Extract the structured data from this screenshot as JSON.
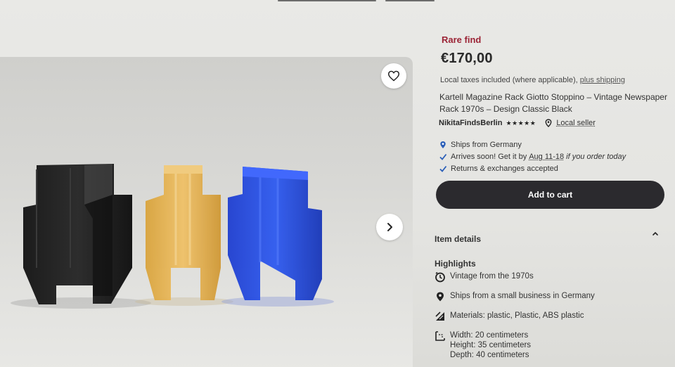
{
  "product": {
    "badge": "Rare find",
    "price": "€170,00",
    "taxes_text": "Local taxes included (where applicable), ",
    "shipping_link": "plus shipping",
    "title": "Kartell Magazine Rack Giotto Stoppino – Vintage Newspaper Rack 1970s – Design Classic Black"
  },
  "seller": {
    "name": "NikitaFindsBerlin",
    "rating": "★★★★★",
    "local_label": "Local seller"
  },
  "shipping_info": {
    "ships_from": "Ships from Germany",
    "arrives_prefix": "Arrives soon! Get it by",
    "arrives_date": "Aug 11-18",
    "arrives_suffix": "if you order today",
    "returns": "Returns & exchanges accepted"
  },
  "actions": {
    "add_to_cart": "Add to cart"
  },
  "details": {
    "section_title": "Item details",
    "highlights_title": "Highlights",
    "vintage": "Vintage from the 1970s",
    "ships_small": "Ships from a small business in Germany",
    "materials": "Materials: plastic, Plastic, ABS plastic",
    "width": "Width: 20 centimeters",
    "height": "Height: 35 centimeters",
    "depth": "Depth: 40 centimeters"
  },
  "icons": {
    "favorite": "heart-icon",
    "next": "chevron-right-icon",
    "location": "pin-icon",
    "check": "check-icon",
    "collapse": "chevron-up-icon",
    "clock": "clock-icon",
    "materials": "materials-icon",
    "dimensions": "ruler-icon"
  },
  "colors": {
    "badge": "#9b2335",
    "cart_button": "#2b2a2e",
    "check_blue": "#2b5fb8"
  }
}
